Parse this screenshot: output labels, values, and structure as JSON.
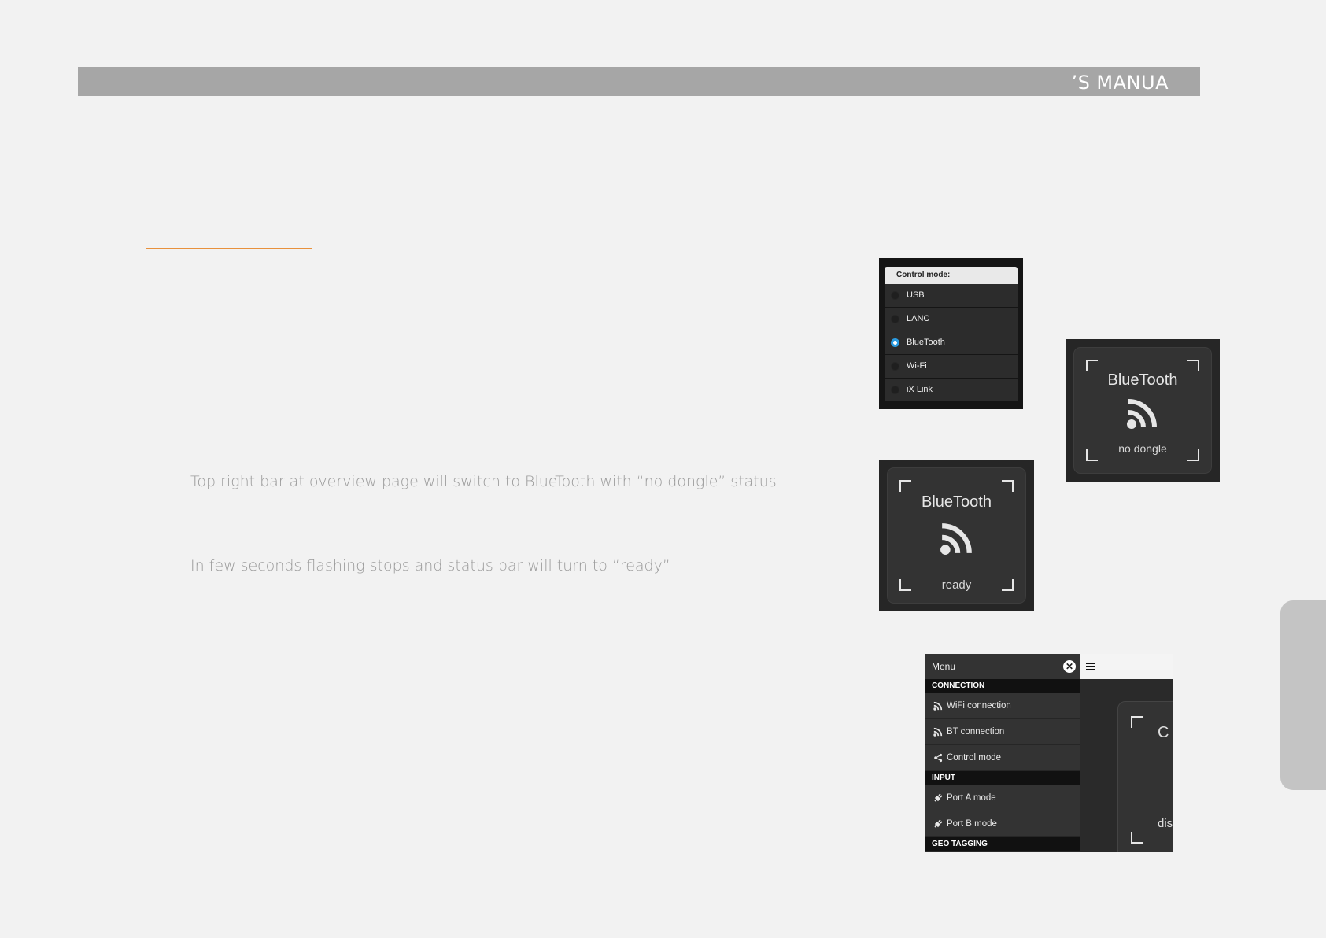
{
  "header": {
    "title": "’S MANUA"
  },
  "body": {
    "line1": "Top right bar at overview page will switch to BlueTooth with “no dongle” status",
    "line2": "In few seconds flashing stops and status bar will turn to “ready”"
  },
  "control_mode": {
    "header": "Control mode:",
    "items": [
      {
        "label": "USB",
        "checked": false
      },
      {
        "label": "LANC",
        "checked": false
      },
      {
        "label": "BlueTooth",
        "checked": true
      },
      {
        "label": "Wi-Fi",
        "checked": false
      },
      {
        "label": "iX Link",
        "checked": false
      }
    ]
  },
  "bt_no_dongle": {
    "title": "BlueTooth",
    "status": "no dongle",
    "icon": "rss-icon"
  },
  "bt_ready": {
    "title": "BlueTooth",
    "status": "ready",
    "icon": "rss-icon"
  },
  "menu": {
    "title": "Menu",
    "close_icon": "close-icon",
    "sections": [
      {
        "label": "CONNECTION",
        "items": [
          {
            "label": "WiFi connection",
            "icon": "rss-icon"
          },
          {
            "label": "BT connection",
            "icon": "rss-icon"
          },
          {
            "label": "Control mode",
            "icon": "share-icon"
          }
        ]
      },
      {
        "label": "INPUT",
        "items": [
          {
            "label": "Port A mode",
            "icon": "plug-icon"
          },
          {
            "label": "Port B mode",
            "icon": "plug-icon"
          }
        ]
      },
      {
        "label": "GEO TAGGING",
        "items": []
      }
    ],
    "background_partial": {
      "text_top": "C",
      "text_bottom": "dis"
    }
  },
  "colors": {
    "accent": "#e8913d",
    "radio_checked": "#2b9be0",
    "header_bar": "#a6a6a6"
  }
}
